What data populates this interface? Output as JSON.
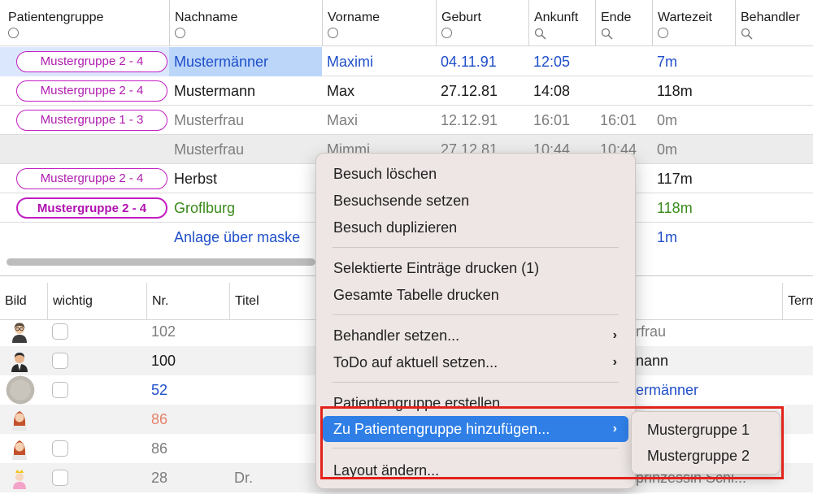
{
  "top_table": {
    "columns": [
      "Patientengruppe",
      "Nachname",
      "Vorname",
      "Geburt",
      "Ankunft",
      "Ende",
      "Wartezeit",
      "Behandler"
    ],
    "filter_icons": [
      "circle",
      "circle",
      "circle",
      "circle",
      "magnifier",
      "magnifier",
      "circle",
      "magnifier"
    ],
    "rows": [
      {
        "group": "Mustergruppe 2 - 4",
        "group_bold": false,
        "nachname": "Mustermänner",
        "vorname": "Maximi",
        "geburt": "04.11.91",
        "ankunft": "12:05",
        "ende": "",
        "wartezeit": "7m",
        "style": "blue",
        "selected": true
      },
      {
        "group": "Mustergruppe 2 - 4",
        "group_bold": false,
        "nachname": "Mustermann",
        "vorname": "Max",
        "geburt": "27.12.81",
        "ankunft": "14:08",
        "ende": "",
        "wartezeit": "118m",
        "style": "normal",
        "selected": false
      },
      {
        "group": "Mustergruppe 1 - 3",
        "group_bold": false,
        "nachname": "Musterfrau",
        "vorname": "Maxi",
        "geburt": "12.12.91",
        "ankunft": "16:01",
        "ende": "16:01",
        "wartezeit": "0m",
        "style": "gray",
        "selected": false
      },
      {
        "group": "",
        "group_bold": false,
        "nachname": "Musterfrau",
        "vorname": "Mimmi",
        "geburt": "27.12.81",
        "ankunft": "10:44",
        "ende": "10:44",
        "wartezeit": "0m",
        "style": "gray",
        "selected": false,
        "shaded": true
      },
      {
        "group": "Mustergruppe 2 - 4",
        "group_bold": false,
        "nachname": "Herbst",
        "vorname": "",
        "geburt": "",
        "ankunft": "",
        "ende": "",
        "wartezeit": "117m",
        "style": "normal",
        "selected": false
      },
      {
        "group": "Mustergruppe 2 - 4",
        "group_bold": true,
        "nachname": "Groflburg",
        "vorname": "",
        "geburt": "",
        "ankunft": "",
        "ende": "",
        "wartezeit": "118m",
        "style": "green",
        "selected": false
      },
      {
        "group": "",
        "group_bold": false,
        "nachname": "Anlage über maske",
        "vorname": "",
        "geburt": "",
        "ankunft": "",
        "ende": "",
        "wartezeit": "1m",
        "style": "blue",
        "selected": false
      }
    ]
  },
  "bottom_table": {
    "columns": [
      "Bild",
      "wichtig",
      "Nr.",
      "Titel",
      "Term"
    ],
    "rows": [
      {
        "avatar": "woman-glasses",
        "checkbox": true,
        "nr": "102",
        "titel": "",
        "name": "rfrau",
        "style": "gray"
      },
      {
        "avatar": "man-suit",
        "checkbox": true,
        "nr": "100",
        "titel": "",
        "name": "nann",
        "style": "normal"
      },
      {
        "avatar": "placeholder-photo",
        "checkbox": true,
        "nr": "52",
        "titel": "",
        "name": "ermänner",
        "style": "blue"
      },
      {
        "avatar": "woman-redhead",
        "checkbox": false,
        "nr": "86",
        "titel": "",
        "name": "",
        "style": "orange"
      },
      {
        "avatar": "woman-redhead",
        "checkbox": true,
        "nr": "86",
        "titel": "",
        "name": "",
        "style": "gray"
      },
      {
        "avatar": "princess",
        "checkbox": true,
        "nr": "28",
        "titel": "Dr.",
        "name": "prinzessin Schi...",
        "style": "gray"
      }
    ]
  },
  "context_menu": {
    "items": [
      {
        "label": "Besuch löschen"
      },
      {
        "label": "Besuchsende setzen"
      },
      {
        "label": "Besuch duplizieren"
      },
      {
        "label": "Selektierte Einträge drucken (1)"
      },
      {
        "label": "Gesamte Tabelle drucken"
      },
      {
        "label": "Behandler setzen...",
        "submenu": true
      },
      {
        "label": "ToDo auf aktuell setzen...",
        "submenu": true
      },
      {
        "label": "Patientengruppe erstellen"
      },
      {
        "label": "Zu Patientengruppe hinzufügen...",
        "submenu": true,
        "highlighted": true
      },
      {
        "label": "Layout ändern..."
      }
    ],
    "submenu_arrow": "›"
  },
  "submenu": {
    "items": [
      "Mustergruppe 1",
      "Mustergruppe 2"
    ]
  },
  "colors": {
    "accent_blue": "#2f7fe7",
    "group_pill": "#c21ec2",
    "highlight_box": "#e3221b",
    "text_blue": "#1f4fc9",
    "text_green": "#3a8a1b"
  }
}
